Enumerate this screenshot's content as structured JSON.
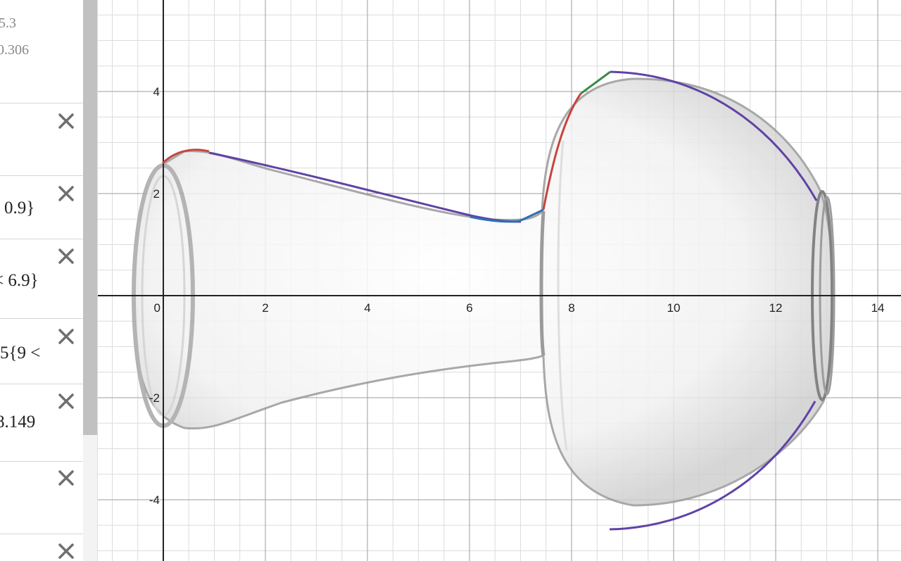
{
  "expressions": {
    "top": {
      "line1": "5.3",
      "line2": "0.306"
    },
    "rows": [
      {
        "text": ""
      },
      {
        "text": "0.9}"
      },
      {
        "text": "< 6.9}"
      },
      {
        "text": "5{9 <"
      },
      {
        "text": "8.149"
      },
      {
        "text": ""
      },
      {
        "text": ""
      }
    ],
    "delete_icon": "close-icon"
  },
  "graph": {
    "x_ticks": [
      "0",
      "2",
      "4",
      "6",
      "8",
      "10",
      "12",
      "14"
    ],
    "y_ticks": [
      "4",
      "2",
      "-2",
      "-4"
    ],
    "xlim": [
      -1.3,
      14.4
    ],
    "ylim": [
      -5.2,
      5.8
    ],
    "grid": true,
    "background_image": "glass-decanter-photo",
    "curve_colors": {
      "red": "#c74440",
      "purple": "#6042a6",
      "blue": "#2d70b3",
      "green": "#388c46"
    }
  }
}
